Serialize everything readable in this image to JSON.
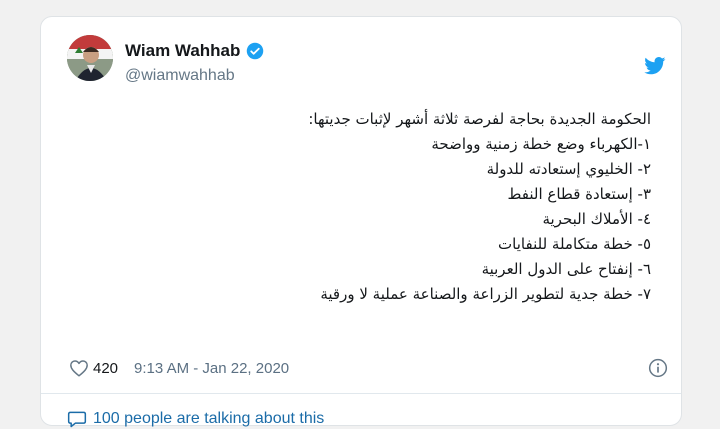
{
  "author": {
    "name": "Wiam Wahhab",
    "handle": "@wiamwahhab"
  },
  "tweet": {
    "lines": [
      "الحكومة الجديدة بحاجة لفرصة ثلاثة أشهر لإثبات جديتها:",
      "١-الكهرباء وضع خطة زمنية وواضحة",
      "٢- الخليوي إستعادته للدولة",
      "٣- إستعادة قطاع النفط",
      "٤- الأملاك البحرية",
      "٥- خطة متكاملة للنفايات",
      "٦- إنفتاح على الدول العربية",
      "٧- خطة جدية لتطوير الزراعة والصناعة عملية لا ورقية"
    ]
  },
  "meta": {
    "likes": "420",
    "timestamp": "9:13 AM - Jan 22, 2020"
  },
  "footer": {
    "talking": "100 people are talking about this"
  },
  "colors": {
    "accent": "#1da1f2",
    "link": "#1b6ca8",
    "text": "#14171a",
    "muted": "#657786"
  },
  "icons": {
    "verified": "verified-badge-icon",
    "brand": "twitter-bird-icon",
    "like": "heart-icon",
    "info": "info-icon",
    "conversation": "speech-bubble-icon"
  }
}
